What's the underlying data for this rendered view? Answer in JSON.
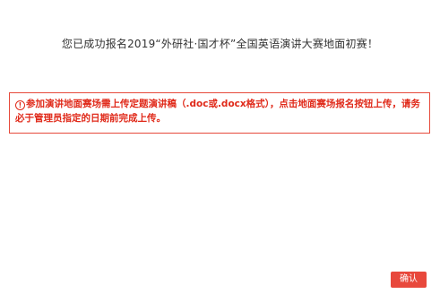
{
  "dialog": {
    "title": "您已成功报名2019“外研社·国才杯”全国英语演讲大赛地面初赛！",
    "notice": {
      "icon": "exclamation-circle-icon",
      "icon_glyph": "!",
      "text": "参加演讲地面赛场需上传定题演讲稿（.doc或.docx格式），点击地面赛场报名按钮上传，请务必于管理员指定的日期前完成上传。"
    },
    "confirm_label": "确认",
    "colors": {
      "accent": "#e8483c",
      "notice_text": "#e02a1a",
      "title_text": "#333333"
    }
  }
}
